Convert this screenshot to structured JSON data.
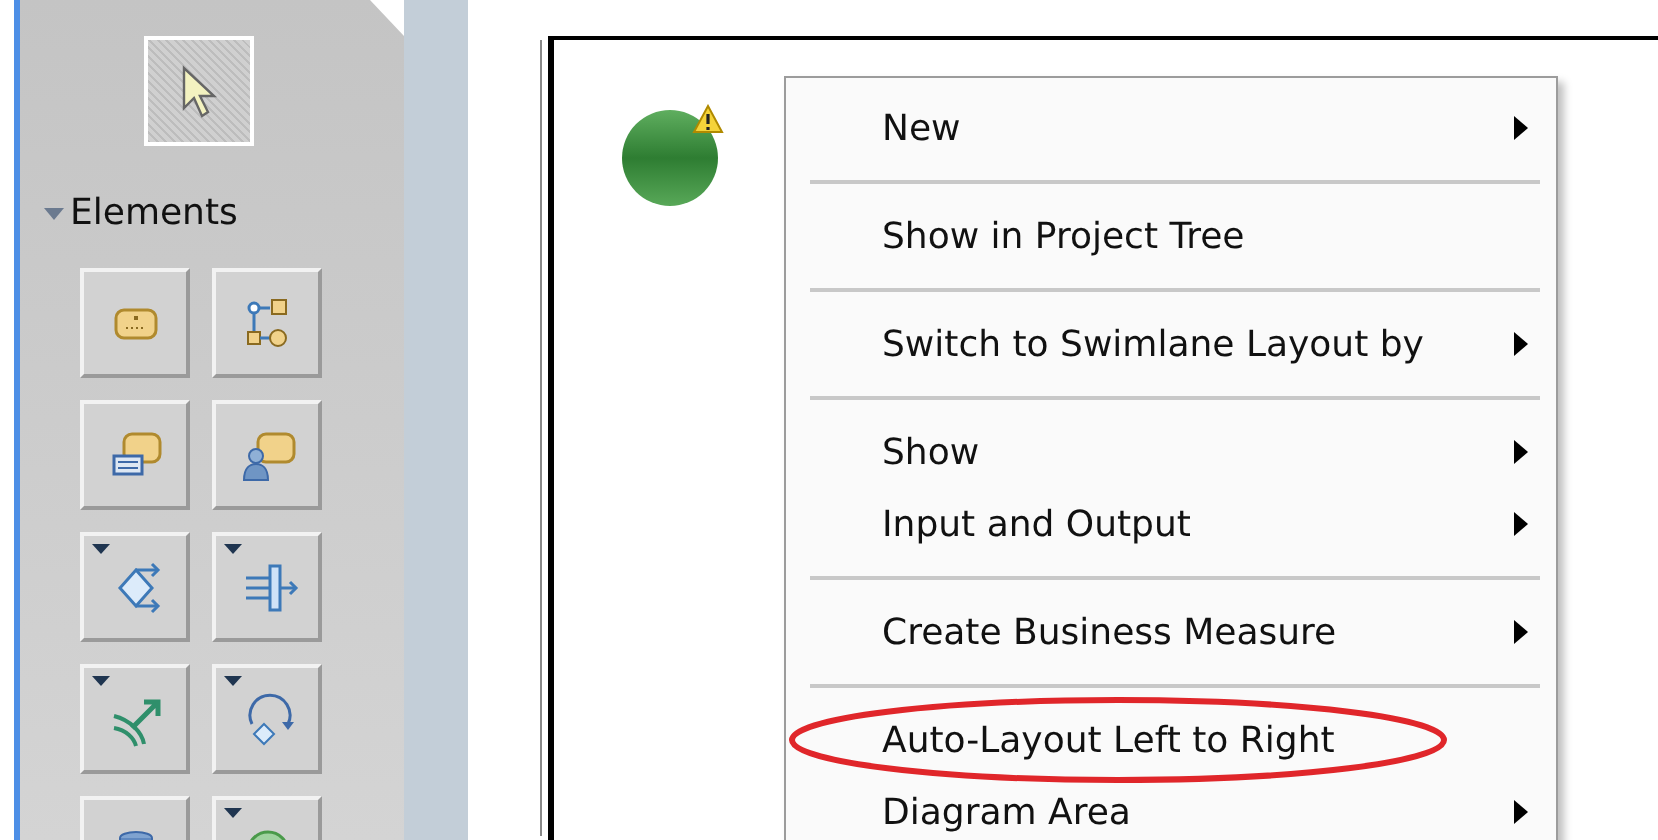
{
  "palette": {
    "select_tool": {
      "selected": true
    },
    "section": {
      "label": "Elements",
      "expanded": true
    },
    "tools": [
      {
        "kind": "task",
        "dropdown": false
      },
      {
        "kind": "process",
        "dropdown": false
      },
      {
        "kind": "business-rule",
        "dropdown": false
      },
      {
        "kind": "human-task",
        "dropdown": false
      },
      {
        "kind": "decision",
        "dropdown": true
      },
      {
        "kind": "fork",
        "dropdown": true
      },
      {
        "kind": "merge",
        "dropdown": true
      },
      {
        "kind": "loop",
        "dropdown": true
      },
      {
        "kind": "datastore",
        "dropdown": false
      },
      {
        "kind": "start",
        "dropdown": true
      }
    ]
  },
  "canvas": {
    "element": {
      "warning": true
    }
  },
  "context_menu": {
    "groups": [
      [
        {
          "label": "New",
          "submenu": true,
          "circled": false
        }
      ],
      [
        {
          "label": "Show in Project Tree",
          "submenu": false,
          "circled": false
        }
      ],
      [
        {
          "label": "Switch to Swimlane Layout by",
          "submenu": true,
          "circled": false
        }
      ],
      [
        {
          "label": "Show",
          "submenu": true,
          "circled": false
        },
        {
          "label": "Input and Output",
          "submenu": true,
          "circled": false
        }
      ],
      [
        {
          "label": "Create Business Measure",
          "submenu": true,
          "circled": false
        }
      ],
      [
        {
          "label": "Auto-Layout Left to Right",
          "submenu": false,
          "circled": true
        },
        {
          "label": "Diagram Area",
          "submenu": true,
          "circled": false
        }
      ]
    ]
  }
}
